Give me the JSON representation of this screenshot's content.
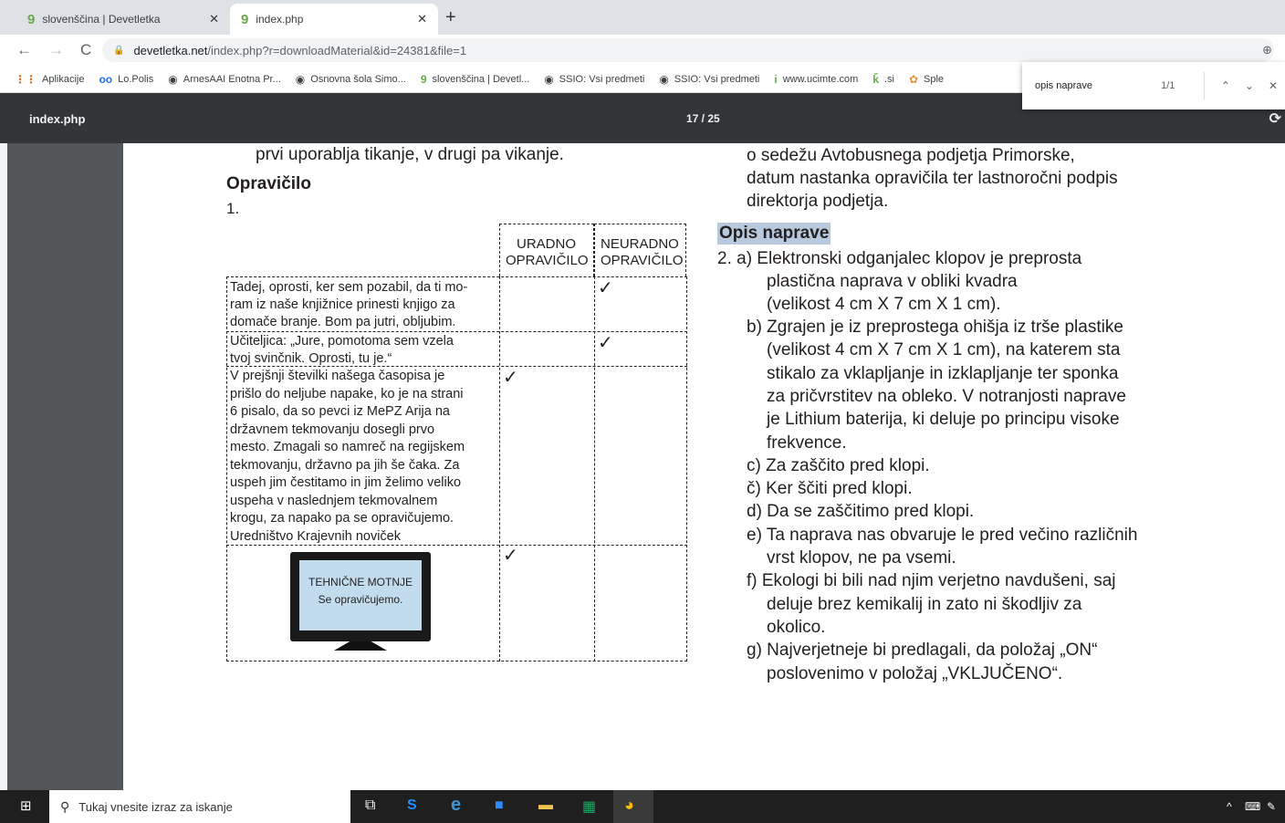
{
  "tabs": [
    {
      "title": "slovenščina | Devetletka"
    },
    {
      "title": "index.php"
    }
  ],
  "address": {
    "host": "devetletka.net",
    "path": "/index.php?r=downloadMaterial&id=24381&file=1"
  },
  "bookmarks": [
    "Aplikacije",
    "Lo.Polis",
    "ArnesAAI Enotna Pr...",
    "Osnovna šola Simo...",
    "slovenščina | Devetl...",
    "SSIO: Vsi predmeti",
    "SSIO: Vsi predmeti",
    "www.ucimte.com",
    ".si",
    "Sple"
  ],
  "find": {
    "query": "opis naprave",
    "count": "1/1"
  },
  "pdf": {
    "filename": "index.php",
    "page": "17 / 25"
  },
  "left": {
    "top_line": "prvi uporablja tikanje, v drugi pa vikanje.",
    "heading": "Opravičilo",
    "number": "1.",
    "col1": [
      "URADNO",
      "OPRAVIČILO"
    ],
    "col2": [
      "NEURADNO",
      "OPRAVIČILO"
    ],
    "row1": [
      "Tadej, oprosti, ker sem pozabil, da ti mo-",
      "ram iz naše knjižnice prinesti knjigo za",
      "domače branje. Bom pa jutri, obljubim."
    ],
    "row2": [
      "Učiteljica: „Jure, pomotoma sem vzela",
      "tvoj svinčnik. Oprosti, tu je.“"
    ],
    "row3": [
      "V prejšnji številki našega časopisa je",
      "prišlo do neljube napake, ko je na strani",
      "6 pisalo, da so pevci iz MePZ Arija na",
      "državnem tekmovanju dosegli prvo",
      "mesto. Zmagali so namreč na regijskem",
      "tekmovanju, državno pa jih še čaka. Za",
      "uspeh jim čestitamo in jim želimo veliko",
      "uspeha v naslednjem tekmovalnem",
      "krogu, za napako pa se opravičujemo.",
      "Uredništvo Krajevnih noviček"
    ],
    "tv_line1": "TEHNIČNE MOTNJE",
    "tv_line2": "Se opravičujemo.",
    "check": "✓"
  },
  "right": {
    "lines_top": [
      "o sedežu Avtobusnega podjetja Primorske,",
      "datum nastanka opravičila ter lastnoročni podpis",
      "direktorja podjetja."
    ],
    "heading": "Opis naprave",
    "lines": [
      "2.   a) Elektronski odganjalec klopov je preprosta",
      "plastična naprava v obliki kvadra",
      "(velikost 4 cm X 7 cm X 1 cm).",
      "b) Zgrajen je iz preprostega ohišja iz trše plastike",
      "(velikost 4 cm X 7 cm X 1 cm), na katerem sta",
      "stikalo za vklapljanje in izklapljanje ter sponka",
      "za pričvrstitev na obleko. V notranjosti naprave",
      "je Lithium baterija, ki deluje po principu visoke",
      "frekvence.",
      "c) Za zaščito pred klopi.",
      "č) Ker ščiti pred klopi.",
      "d) Da se zaščitimo pred klopi.",
      "e) Ta naprava nas obvaruje le pred večino različnih",
      "vrst klopov, ne pa vsemi.",
      "f) Ekologi bi bili nad njim verjetno navdušeni, saj",
      "deluje brez kemikalij in zato ni škodljiv za",
      "okolico.",
      "g) Najverjetneje bi predlagali, da položaj „ON“",
      "poslovenimo v položaj „VKLJUČENO“."
    ]
  },
  "taskbar": {
    "search_placeholder": "Tukaj vnesite izraz za iskanje"
  }
}
